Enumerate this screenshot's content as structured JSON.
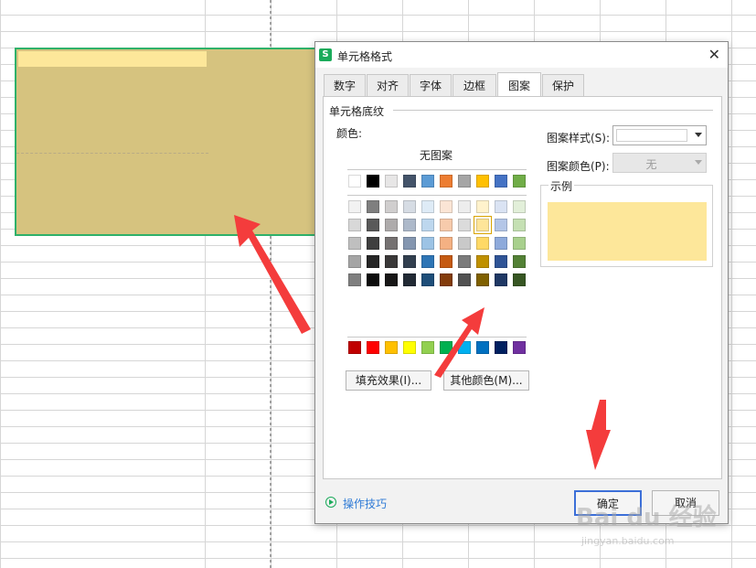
{
  "dialog": {
    "title": "单元格格式",
    "app_icon": "S",
    "close_glyph": "✕",
    "tabs": [
      {
        "label": "数字"
      },
      {
        "label": "对齐"
      },
      {
        "label": "字体"
      },
      {
        "label": "边框"
      },
      {
        "label": "图案",
        "active": true
      },
      {
        "label": "保护"
      }
    ],
    "section_title": "单元格底纹",
    "color_label": "颜色:",
    "no_pattern_label": "无图案",
    "pattern_style_label": "图案样式(S):",
    "pattern_color_label": "图案颜色(P):",
    "pattern_color_value": "无",
    "sample_label": "示例",
    "sample_color": "#fde79a",
    "fill_effect_button": "填充效果(I)...",
    "other_colors_button": "其他颜色(M)...",
    "tips_link": "操作技巧",
    "ok_button": "确定",
    "cancel_button": "取消"
  },
  "palette": {
    "theme_top": [
      "#ffffff",
      "#000000",
      "#e7e6e6",
      "#44546a",
      "#5b9bd5",
      "#ed7d31",
      "#a5a5a5",
      "#ffc000",
      "#4472c4",
      "#70ad47"
    ],
    "theme_tints": [
      [
        "#f2f2f2",
        "#7f7f7f",
        "#d0cece",
        "#d6dce4",
        "#deebf6",
        "#fbe5d5",
        "#ededed",
        "#fff2cc",
        "#dae3f3",
        "#e2efd9"
      ],
      [
        "#d8d8d8",
        "#595959",
        "#aeabab",
        "#adb9ca",
        "#bdd7ee",
        "#f7cbac",
        "#dbdbdb",
        "#fee599",
        "#b4c6e7",
        "#c5e0b3"
      ],
      [
        "#bfbfbf",
        "#3f3f3f",
        "#757171",
        "#8496b0",
        "#9cc3e5",
        "#f4b183",
        "#c9c9c9",
        "#ffd966",
        "#8eaadb",
        "#a8d08d"
      ],
      [
        "#a5a5a5",
        "#262626",
        "#3a3838",
        "#323f4f",
        "#2e75b5",
        "#c55a11",
        "#7b7b7b",
        "#bf9000",
        "#2f5496",
        "#538135"
      ],
      [
        "#7f7f7f",
        "#0c0c0c",
        "#171616",
        "#222a35",
        "#1e4e79",
        "#833c0b",
        "#525252",
        "#7f6000",
        "#1f3864",
        "#375623"
      ]
    ],
    "standard": [
      "#c00000",
      "#ff0000",
      "#ffc000",
      "#ffff00",
      "#92d050",
      "#00b050",
      "#00b0f0",
      "#0070c0",
      "#002060",
      "#7030a0"
    ],
    "selected": "#fee599"
  },
  "sheet": {
    "selection_fill": "#d6c37f",
    "selection_border": "#2fb16a",
    "highlight_fill": "#fde79a"
  },
  "watermark": {
    "brand": "Bai du 经验",
    "url": "jingyan.baidu.com"
  }
}
